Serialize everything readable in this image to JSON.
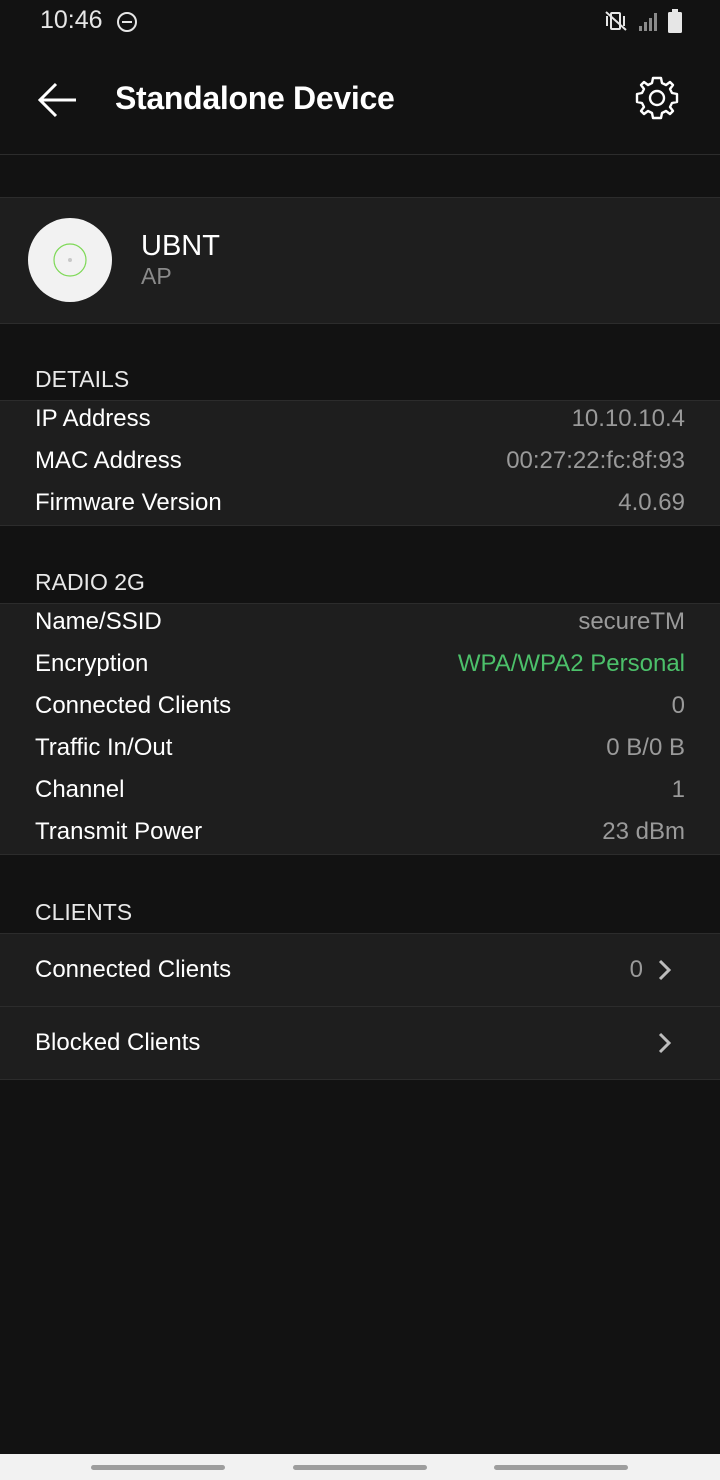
{
  "status_bar": {
    "time": "10:46"
  },
  "app_bar": {
    "title": "Standalone Device"
  },
  "device": {
    "name": "UBNT",
    "type": "AP"
  },
  "details": {
    "header": "DETAILS",
    "rows": [
      {
        "label": "IP Address",
        "value": "10.10.10.4"
      },
      {
        "label": "MAC Address",
        "value": "00:27:22:fc:8f:93"
      },
      {
        "label": "Firmware Version",
        "value": "4.0.69"
      }
    ]
  },
  "radio": {
    "header": "RADIO 2G",
    "rows": [
      {
        "label": "Name/SSID",
        "value": "secureTM"
      },
      {
        "label": "Encryption",
        "value": "WPA/WPA2 Personal"
      },
      {
        "label": "Connected Clients",
        "value": "0"
      },
      {
        "label": "Traffic In/Out",
        "value": "0 B/0 B"
      },
      {
        "label": "Channel",
        "value": "1"
      },
      {
        "label": "Transmit Power",
        "value": "23 dBm"
      }
    ]
  },
  "clients": {
    "header": "CLIENTS",
    "connected_label": "Connected Clients",
    "connected_count": "0",
    "blocked_label": "Blocked Clients"
  },
  "colors": {
    "accent_green": "#4cc06a",
    "background": "#121212",
    "card": "#1e1e1e"
  }
}
